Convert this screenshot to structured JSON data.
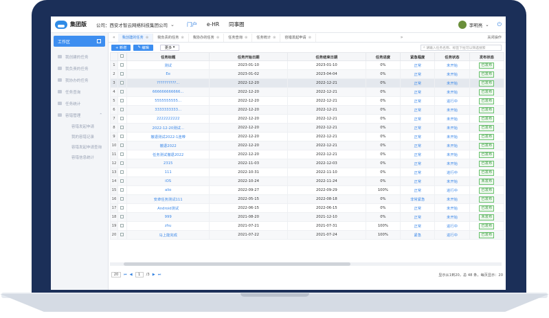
{
  "header": {
    "brand": "集团版",
    "company": "公司：西安才智云网络科技集团公司",
    "nav": [
      "门户",
      "e-HR",
      "同事圈"
    ],
    "user": "李明亮"
  },
  "sidebar": {
    "workbench": "工作区",
    "items": [
      "我创建的任务",
      "我负责的任务",
      "我协办的任务",
      "任务查询",
      "任务统计",
      "容错管理"
    ],
    "subitems": [
      "容错发起申请",
      "我的容错记录",
      "容错发起申请查询",
      "容错信息统计"
    ]
  },
  "tabs": {
    "list": [
      "我创建的任务",
      "我负责的任务",
      "我协办的任务",
      "任务查询",
      "任务统计",
      "容错发起申请"
    ],
    "ops": "关闭操作"
  },
  "toolbar": {
    "new": "+ 新增",
    "edit": "编辑",
    "more": "更多",
    "search_placeholder": "请输入任务名称、标签下拉可以筛选搜索"
  },
  "table": {
    "headers": [
      "",
      "任务标题",
      "任务开始日期",
      "任务结束日期",
      "任务进度",
      "紧急程度",
      "任务状态",
      "发布状态"
    ],
    "rows": [
      [
        "1",
        "测试",
        "2023-01-10",
        "2023-01-10",
        "0%",
        "正常",
        "未开始",
        "已发布"
      ],
      [
        "2",
        "Ee",
        "2023-01-02",
        "2023-04-04",
        "0%",
        "正常",
        "未开始",
        "已发布"
      ],
      [
        "3",
        "??????????...",
        "2022-12-20",
        "2022-12-21",
        "0%",
        "正常",
        "未开始",
        "已发布"
      ],
      [
        "4",
        "666666666666...",
        "2022-12-20",
        "2022-12-21",
        "0%",
        "正常",
        "未开始",
        "已发布"
      ],
      [
        "5",
        "5555555555...",
        "2022-12-20",
        "2022-12-21",
        "0%",
        "正常",
        "进行中",
        "已发布"
      ],
      [
        "6",
        "3333333333...",
        "2022-12-20",
        "2022-12-21",
        "0%",
        "正常",
        "未开始",
        "已发布"
      ],
      [
        "7",
        "2222222222",
        "2022-12-20",
        "2022-12-21",
        "0%",
        "正常",
        "未开始",
        "已发布"
      ],
      [
        "8",
        "2022-12-20测试...",
        "2022-12-20",
        "2022-12-21",
        "0%",
        "正常",
        "未开始",
        "已发布"
      ],
      [
        "9",
        "撤退测试2022-1连带",
        "2022-12-20",
        "2022-12-21",
        "0%",
        "正常",
        "未开始",
        "已发布"
      ],
      [
        "10",
        "撤退2022",
        "2022-12-20",
        "2022-12-21",
        "0%",
        "正常",
        "未开始",
        "已发布"
      ],
      [
        "11",
        "任务测试撤退2022",
        "2022-12-20",
        "2022-12-21",
        "0%",
        "正常",
        "未开始",
        "已发布"
      ],
      [
        "12",
        "2315",
        "2022-11-03",
        "2022-12-03",
        "0%",
        "正常",
        "未开始",
        "已发布"
      ],
      [
        "13",
        "111",
        "2022-10-31",
        "2022-11-10",
        "0%",
        "正常",
        "进行中",
        "已发布"
      ],
      [
        "14",
        "iOS",
        "2022-10-24",
        "2022-11-24",
        "0%",
        "正常",
        "未开始",
        "未发布"
      ],
      [
        "15",
        "alio",
        "2022-09-27",
        "2022-09-29",
        "100%",
        "正常",
        "进行中",
        "已发布"
      ],
      [
        "16",
        "安卓任务测试111",
        "2022-05-15",
        "2022-08-18",
        "0%",
        "非常紧急",
        "未开始",
        "已发布"
      ],
      [
        "17",
        "Android测试",
        "2022-06-15",
        "2022-06-15",
        "0%",
        "正常",
        "未开始",
        "已发布"
      ],
      [
        "18",
        "999",
        "2021-08-20",
        "2021-12-10",
        "0%",
        "正常",
        "未开始",
        "未发布"
      ],
      [
        "19",
        "zhu",
        "2021-07-21",
        "2021-07-31",
        "100%",
        "正常",
        "进行中",
        "已发布"
      ],
      [
        "20",
        "马上能完成",
        "2021-07-22",
        "2021-07-24",
        "100%",
        "紧急",
        "进行中",
        "已发布"
      ]
    ]
  },
  "pager": {
    "size": "20",
    "page": "1",
    "total": "/3",
    "info": "显示从1到20，总 48 条，每页显示：20"
  }
}
